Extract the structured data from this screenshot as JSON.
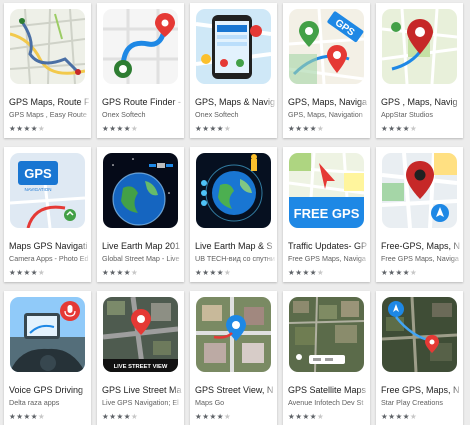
{
  "apps": [
    {
      "title": "GPS Maps, Route F",
      "developer": "GPS Maps , Easy Route",
      "rating": 4,
      "icon": "street-map-route-icon"
    },
    {
      "title": "GPS Route Finder -",
      "developer": "Onex Softech",
      "rating": 4,
      "icon": "route-finder-icon"
    },
    {
      "title": "GPS, Maps & Navig",
      "developer": "Onex Softech",
      "rating": 4,
      "icon": "phone-map-icon"
    },
    {
      "title": "GPS, Maps, Naviga",
      "developer": "GPS, Maps, Navigation",
      "rating": 4,
      "icon": "gps-map-pin-icon"
    },
    {
      "title": "GPS , Maps, Navig",
      "developer": "AppStar Studios",
      "rating": 4,
      "icon": "map-pin-icon"
    },
    {
      "title": "Maps GPS Navigati",
      "developer": "Camera Apps - Photo Ed",
      "rating": 4,
      "icon": "gps-navigation-icon"
    },
    {
      "title": "Live Earth Map 201",
      "developer": "Global Street Map - Live",
      "rating": 4,
      "icon": "earth-satellite-icon"
    },
    {
      "title": "Live Earth Map & S",
      "developer": "UB TECH-вид со спутни",
      "rating": 4,
      "icon": "earth-globe-icon"
    },
    {
      "title": "Traffic Updates- GP",
      "developer": "Free GPS Maps, Naviga",
      "rating": 4,
      "icon": "free-gps-icon"
    },
    {
      "title": "Free-GPS, Maps, N",
      "developer": "Free GPS Maps, Naviga",
      "rating": 4,
      "icon": "free-gps-pin-icon"
    },
    {
      "title": "Voice GPS Driving",
      "developer": "Delta raza apps",
      "rating": 4,
      "icon": "voice-driving-icon"
    },
    {
      "title": "GPS Live Street Ma",
      "developer": "Live GPS Navigation; El",
      "rating": 4,
      "icon": "live-street-view-icon"
    },
    {
      "title": "GPS Street View, N",
      "developer": "Maps Go",
      "rating": 4,
      "icon": "street-view-pin-icon"
    },
    {
      "title": "GPS Satellite Maps",
      "developer": "Avenue Infotech Dev St",
      "rating": 4,
      "icon": "satellite-map-icon"
    },
    {
      "title": "Free GPS, Maps, N",
      "developer": "Star Play Creations",
      "rating": 4,
      "icon": "satellite-navigation-icon"
    }
  ],
  "badges": {
    "gps": "GPS",
    "navigation": "NAVIGATION",
    "free_gps": "FREE GPS",
    "live_street_view": "LIVE STREET VIEW"
  },
  "colors": {
    "background": "#ececec",
    "card": "#ffffff",
    "pin_red": "#e53935",
    "gps_blue": "#1e88e5",
    "map_green": "#8bc34a"
  }
}
